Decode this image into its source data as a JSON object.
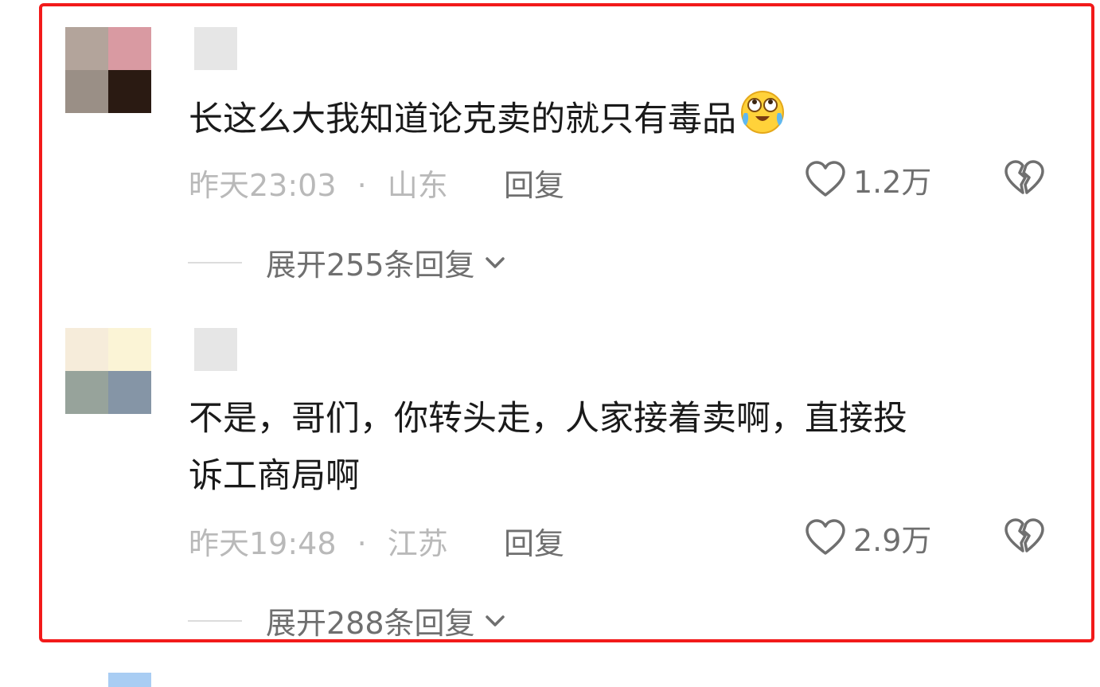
{
  "comments": [
    {
      "avatar_colors": [
        "#b3a49b",
        "#d99aa2",
        "#9a8f86",
        "#2a1a12"
      ],
      "text": "长这么大我知道论克卖的就只有毒品",
      "emoji": "crying-laughing-emoji",
      "time": "昨天23:03",
      "separator": "·",
      "location": "山东",
      "reply_label": "回复",
      "likes": "1.2万",
      "expand_label": "展开255条回复"
    },
    {
      "avatar_colors": [
        "#f6ecda",
        "#fbf4d6",
        "#97a39b",
        "#8595a6"
      ],
      "text": "不是，哥们，你转头走，人家接着卖啊，直接投\n诉工商局啊",
      "time": "昨天19:48",
      "separator": "·",
      "location": "江苏",
      "reply_label": "回复",
      "likes": "2.9万",
      "expand_label": "展开288条回复"
    }
  ],
  "next_avatar_color": "#a9cdf3",
  "colors": {
    "frame": "#f21a1a",
    "text": "#1a1a1a",
    "meta": "#b9b9b9",
    "action": "#6f6f6f"
  },
  "icons": {
    "like": "heart-outline-icon",
    "dislike": "broken-heart-icon",
    "expand": "chevron-down-icon"
  }
}
